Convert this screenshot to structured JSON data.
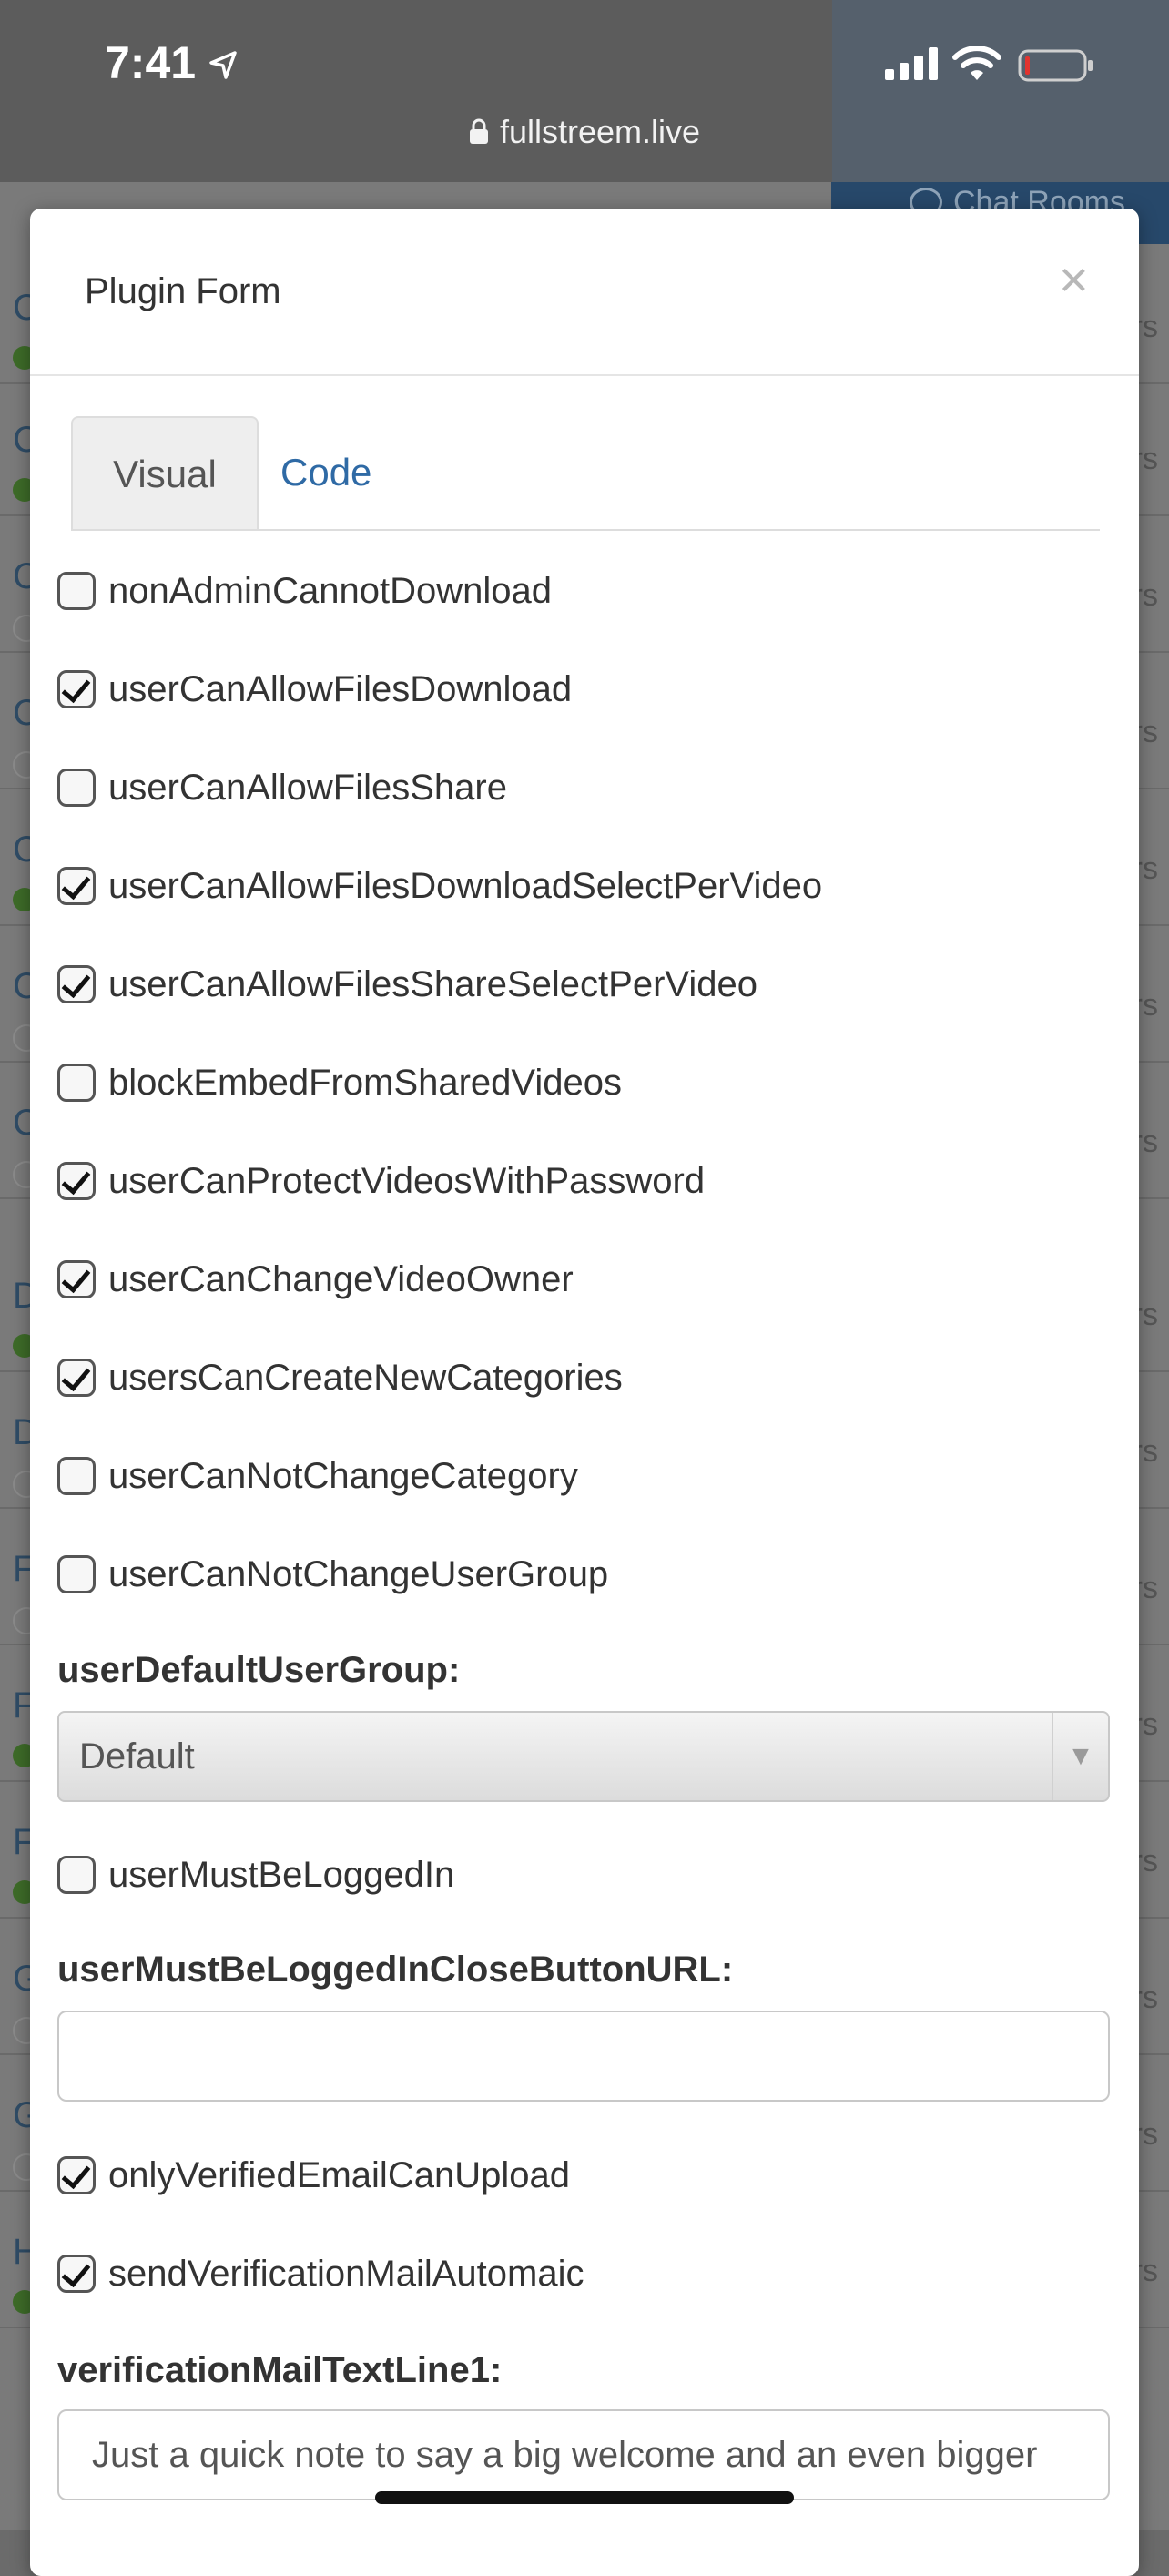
{
  "status_bar": {
    "time": "7:41",
    "url": "fullstreem.live"
  },
  "background": {
    "chat_tab_label": "Chat Rooms",
    "row_letters": [
      "C",
      "C",
      "C",
      "C",
      "C",
      "C",
      "C",
      "D",
      "D",
      "F",
      "F",
      "F",
      "G",
      "G",
      "H"
    ],
    "row_suffix": "rs"
  },
  "modal": {
    "title": "Plugin Form",
    "close_label": "×",
    "tabs": [
      {
        "label": "Visual",
        "active": true
      },
      {
        "label": "Code",
        "active": false
      }
    ],
    "options_group1": [
      {
        "label": "nonAdminCannotDownload",
        "checked": false
      },
      {
        "label": "userCanAllowFilesDownload",
        "checked": true
      },
      {
        "label": "userCanAllowFilesShare",
        "checked": false
      },
      {
        "label": "userCanAllowFilesDownloadSelectPerVideo",
        "checked": true
      },
      {
        "label": "userCanAllowFilesShareSelectPerVideo",
        "checked": true
      },
      {
        "label": "blockEmbedFromSharedVideos",
        "checked": false
      },
      {
        "label": "userCanProtectVideosWithPassword",
        "checked": true
      },
      {
        "label": "userCanChangeVideoOwner",
        "checked": true
      },
      {
        "label": "usersCanCreateNewCategories",
        "checked": true
      },
      {
        "label": "userCanNotChangeCategory",
        "checked": false
      },
      {
        "label": "userCanNotChangeUserGroup",
        "checked": false
      }
    ],
    "default_group": {
      "label": "userDefaultUserGroup:",
      "selected": "Default"
    },
    "must_be_logged_in": {
      "label": "userMustBeLoggedIn",
      "checked": false
    },
    "close_button_url": {
      "label": "userMustBeLoggedInCloseButtonURL:",
      "value": ""
    },
    "options_group2": [
      {
        "label": "onlyVerifiedEmailCanUpload",
        "checked": true
      },
      {
        "label": "sendVerificationMailAutomaic",
        "checked": true
      }
    ],
    "verification_line1": {
      "label": "verificationMailTextLine1:",
      "value": "Just a quick note to say a big welcome and an even bigger"
    }
  }
}
